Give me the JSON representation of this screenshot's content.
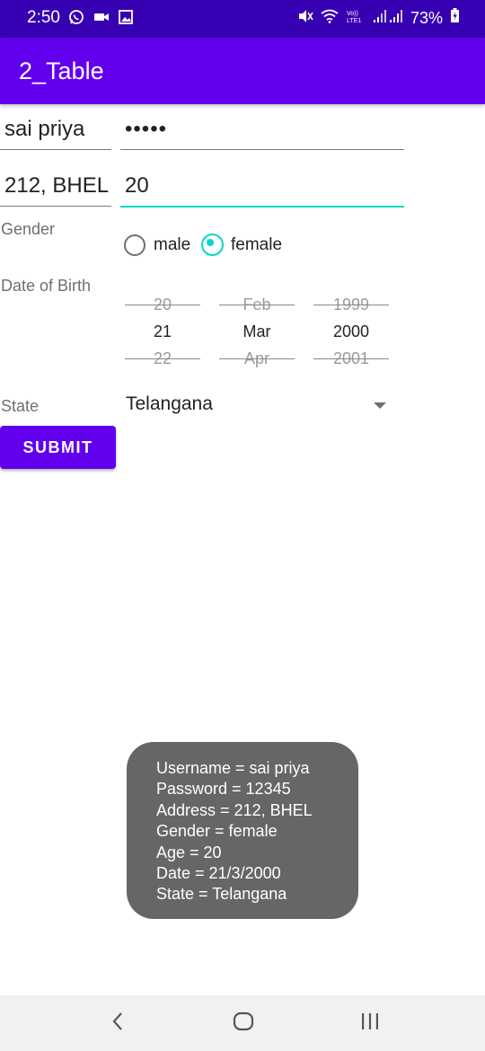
{
  "status_bar": {
    "time": "2:50",
    "battery": "73%",
    "icons": [
      "whatsapp-icon",
      "video-icon",
      "gallery-icon",
      "mute-icon",
      "wifi-icon",
      "volte-icon",
      "signal-icon",
      "battery-icon"
    ]
  },
  "app_bar": {
    "title": "2_Table"
  },
  "form": {
    "username": "sai priya",
    "password": "•••••",
    "address": "212, BHEL",
    "age": "20",
    "gender_label": "Gender",
    "gender_options": [
      {
        "label": "male",
        "checked": false
      },
      {
        "label": "female",
        "checked": true
      }
    ],
    "dob_label": "Date of Birth",
    "dob_picker": {
      "day": [
        "20",
        "21",
        "22"
      ],
      "month": [
        "Feb",
        "Mar",
        "Apr"
      ],
      "year": [
        "1999",
        "2000",
        "2001"
      ]
    },
    "state_label": "State",
    "state_value": "Telangana",
    "submit_label": "SUBMIT"
  },
  "toast": {
    "lines": [
      "Username = sai priya",
      "Password = 12345",
      "Address = 212, BHEL",
      "Gender = female",
      "Age = 20",
      "Date = 21/3/2000",
      "State = Telangana"
    ]
  },
  "nav_bar": {
    "buttons": [
      "back-icon",
      "home-icon",
      "recents-icon"
    ]
  },
  "colors": {
    "status_bar": "#3700b3",
    "primary": "#6200ee",
    "accent": "#03dac5",
    "toast_bg": "#666666"
  }
}
